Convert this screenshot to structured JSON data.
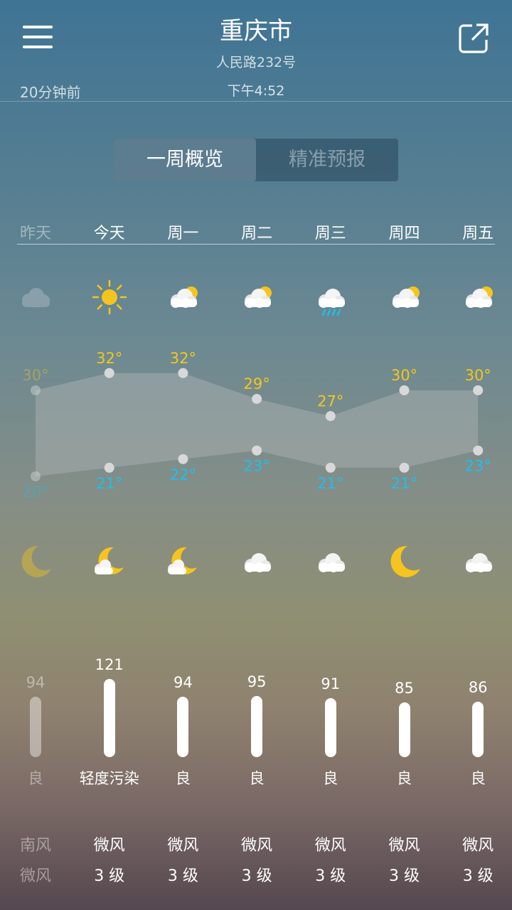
{
  "header": {
    "city": "重庆市",
    "address": "人民路232号",
    "updated": "20分钟前",
    "publish_time": "下午4:52"
  },
  "tabs": [
    {
      "label": "一周概览",
      "active": true
    },
    {
      "label": "精准预报",
      "active": false
    }
  ],
  "days": [
    {
      "label": "昨天",
      "day_icon": "cloudy-icon",
      "high": "30°",
      "low": "20°",
      "night_icon": "moon-icon",
      "aqi": 94,
      "aqi_level": "良",
      "wind_dir": "南风",
      "wind_level": "微风",
      "past": true
    },
    {
      "label": "今天",
      "day_icon": "sun-icon",
      "high": "32°",
      "low": "21°",
      "night_icon": "moon-cloud-icon",
      "aqi": 121,
      "aqi_level": "轻度污染",
      "wind_dir": "微风",
      "wind_level": "3 级",
      "past": false
    },
    {
      "label": "周一",
      "day_icon": "partly-cloudy-icon",
      "high": "32°",
      "low": "22°",
      "night_icon": "moon-cloud-icon",
      "aqi": 94,
      "aqi_level": "良",
      "wind_dir": "微风",
      "wind_level": "3 级",
      "past": false
    },
    {
      "label": "周二",
      "day_icon": "partly-cloudy-icon",
      "high": "29°",
      "low": "23°",
      "night_icon": "cloud-icon",
      "aqi": 95,
      "aqi_level": "良",
      "wind_dir": "微风",
      "wind_level": "3 级",
      "past": false
    },
    {
      "label": "周三",
      "day_icon": "rain-icon",
      "high": "27°",
      "low": "21°",
      "night_icon": "cloud-icon",
      "aqi": 91,
      "aqi_level": "良",
      "wind_dir": "微风",
      "wind_level": "3 级",
      "past": false
    },
    {
      "label": "周四",
      "day_icon": "partly-cloudy-icon",
      "high": "30°",
      "low": "21°",
      "night_icon": "moon-icon",
      "aqi": 85,
      "aqi_level": "良",
      "wind_dir": "微风",
      "wind_level": "3 级",
      "past": false
    },
    {
      "label": "周五",
      "day_icon": "partly-cloudy-icon",
      "high": "30°",
      "low": "23°",
      "night_icon": "cloud-icon",
      "aqi": 86,
      "aqi_level": "良",
      "wind_dir": "微风",
      "wind_level": "3 级",
      "past": false
    }
  ],
  "colors": {
    "high": "#f2c81c",
    "low": "#1ec0ee",
    "sun": "#f5c41f"
  }
}
